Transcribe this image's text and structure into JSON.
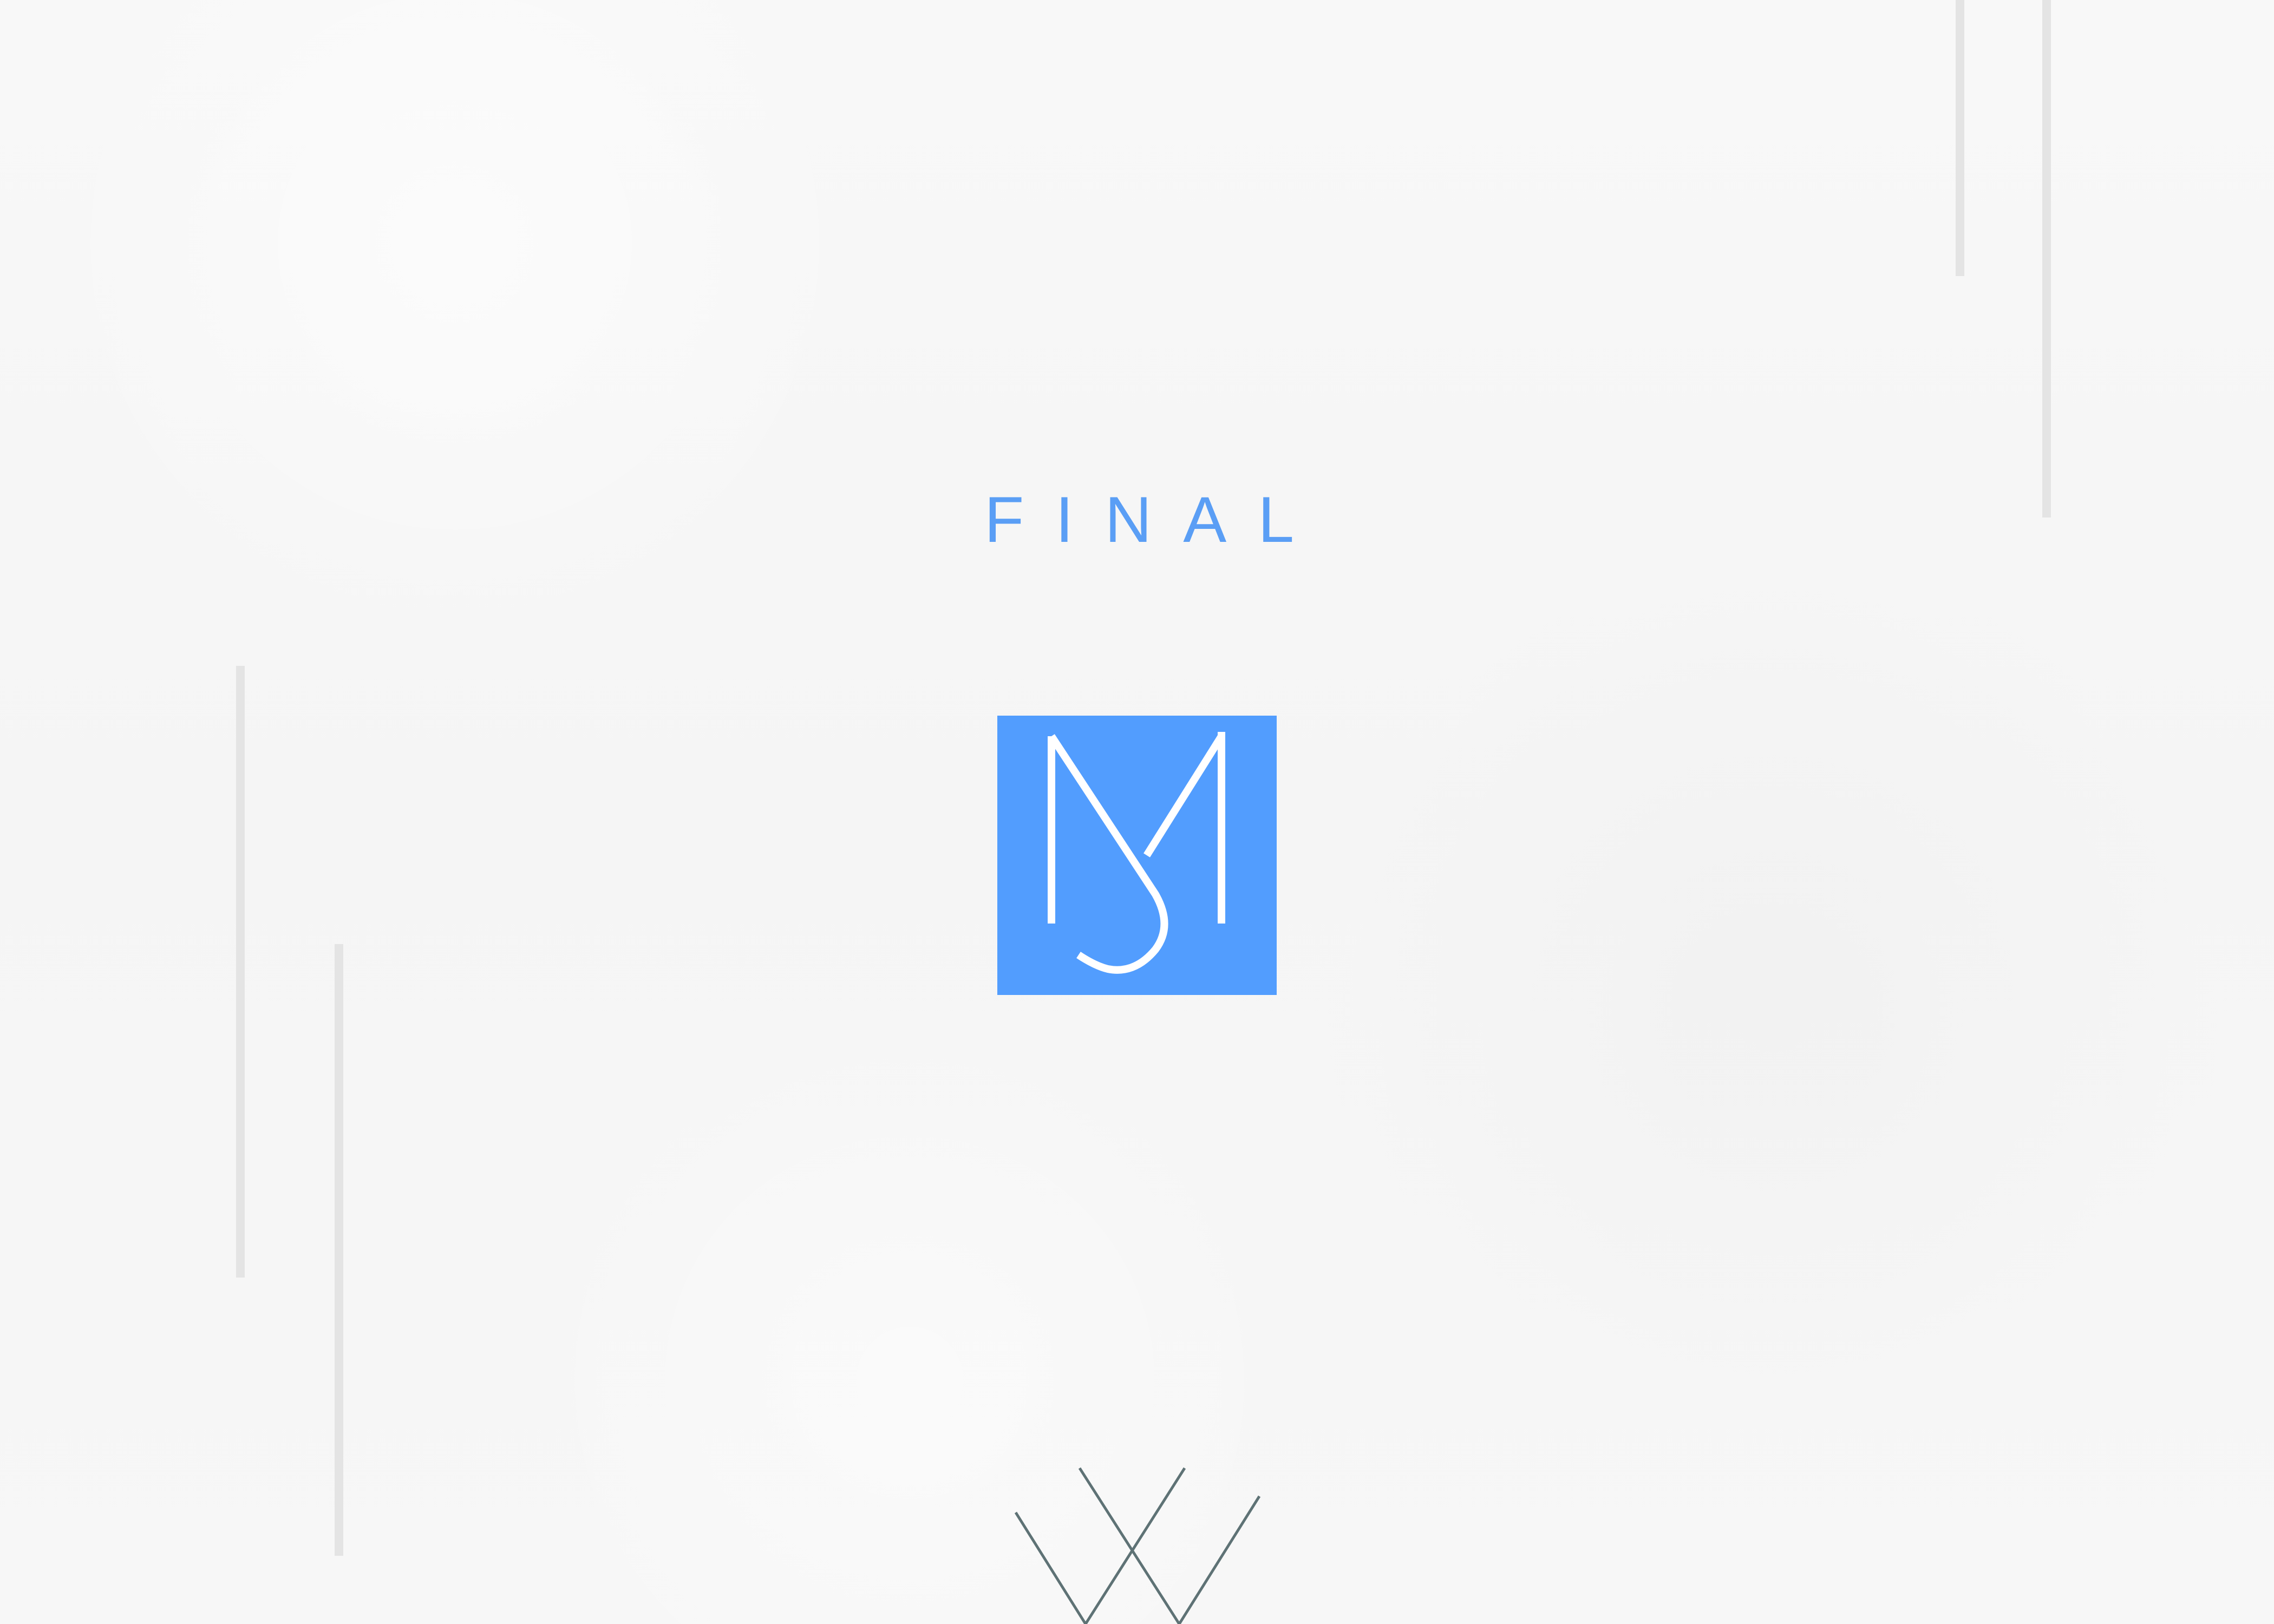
{
  "title": "FINAL",
  "logo": {
    "name": "mj-monogram-logo",
    "background_color": "#529dfe",
    "stroke_color": "#ffffff"
  },
  "decor": {
    "line_color": "#e4e4e4",
    "bottom_mark_color": "#5e7275"
  }
}
